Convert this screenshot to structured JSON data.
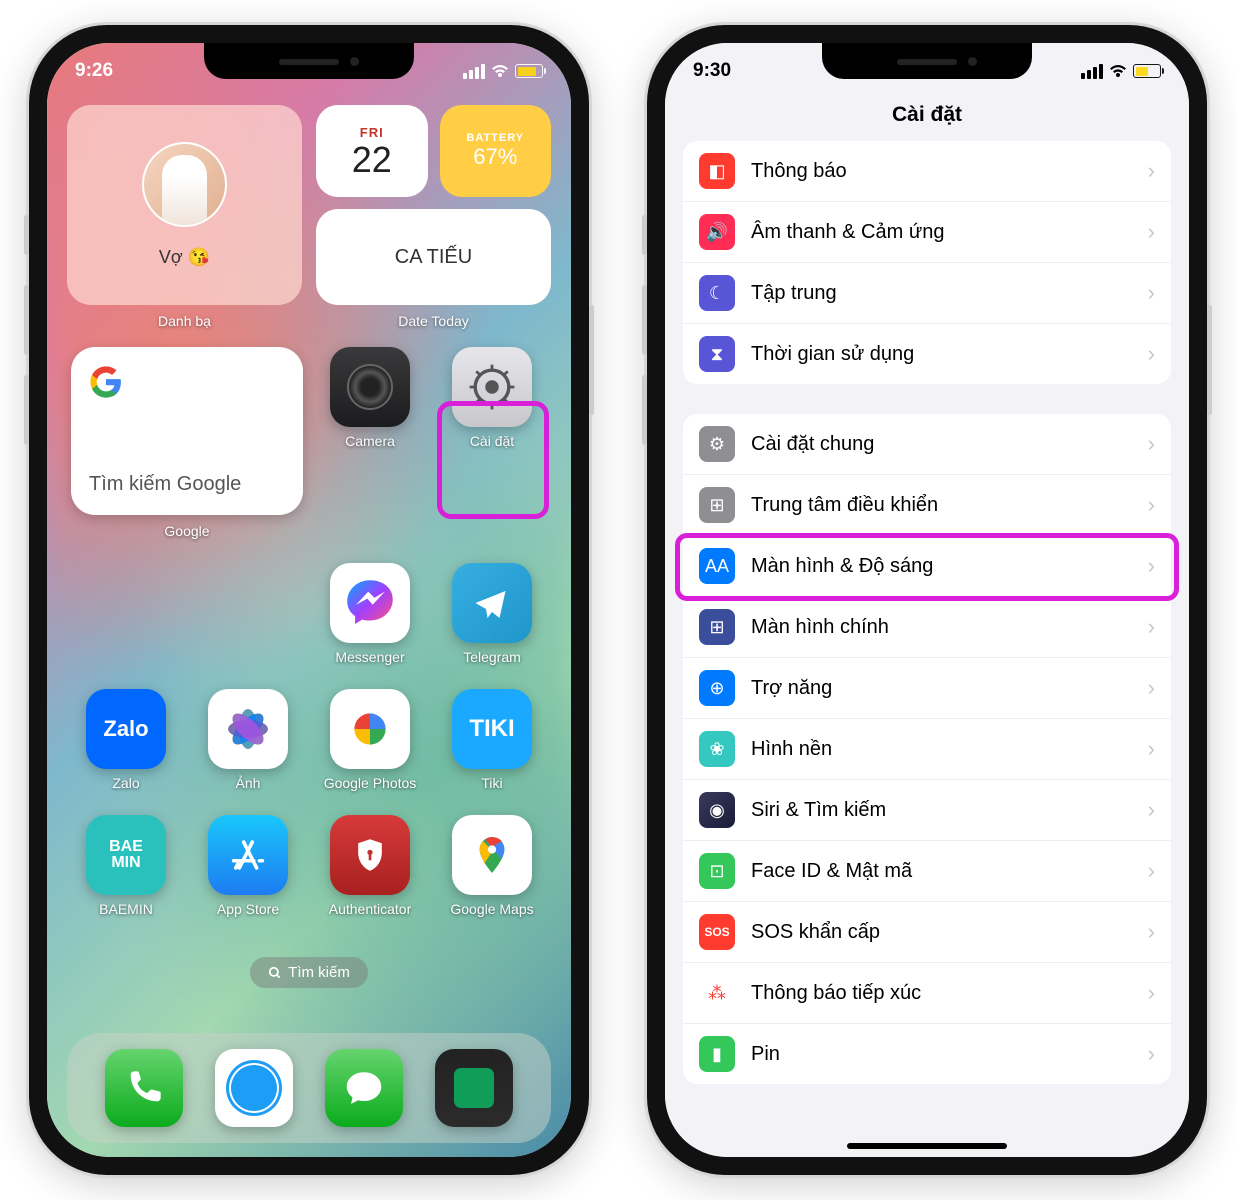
{
  "phone_left": {
    "status": {
      "time": "9:26"
    },
    "widgets": {
      "contact": {
        "name": "Vợ 😘",
        "section_label": "Danh bạ"
      },
      "date": {
        "day": "FRI",
        "num": "22"
      },
      "battery": {
        "label": "BATTERY",
        "percent": "67%"
      },
      "calendar": {
        "text": "CA TIẾU"
      },
      "date_section_label": "Date Today"
    },
    "google_widget": {
      "text": "Tìm kiếm Google",
      "label": "Google"
    },
    "apps": {
      "camera": "Camera",
      "settings": "Cài đặt",
      "messenger": "Messenger",
      "telegram": "Telegram",
      "zalo": "Zalo",
      "zalo_text": "Zalo",
      "photos": "Ảnh",
      "gphotos": "Google Photos",
      "tiki": "Tiki",
      "tiki_text": "TIKI",
      "baemin": "BAEMIN",
      "baemin_text": "BAE\nMIN",
      "appstore": "App Store",
      "auth": "Authenticator",
      "gmaps": "Google Maps"
    },
    "search": "Tìm kiếm"
  },
  "phone_right": {
    "status": {
      "time": "9:30"
    },
    "title": "Cài đặt",
    "group1": [
      {
        "id": "notifications",
        "label": "Thông báo",
        "icon_cls": "si-notif",
        "glyph": "◧"
      },
      {
        "id": "sounds",
        "label": "Âm thanh & Cảm ứng",
        "icon_cls": "si-sound",
        "glyph": "🔊"
      },
      {
        "id": "focus",
        "label": "Tập trung",
        "icon_cls": "si-focus",
        "glyph": "☾"
      },
      {
        "id": "screentime",
        "label": "Thời gian sử dụng",
        "icon_cls": "si-screentime",
        "glyph": "⧗"
      }
    ],
    "group2": [
      {
        "id": "general",
        "label": "Cài đặt chung",
        "icon_cls": "si-general",
        "glyph": "⚙"
      },
      {
        "id": "control-center",
        "label": "Trung tâm điều khiển",
        "icon_cls": "si-cc",
        "glyph": "⊞"
      },
      {
        "id": "display",
        "label": "Màn hình & Độ sáng",
        "icon_cls": "si-display",
        "glyph": "AA"
      },
      {
        "id": "home-screen",
        "label": "Màn hình chính",
        "icon_cls": "si-home",
        "glyph": "⊞"
      },
      {
        "id": "accessibility",
        "label": "Trợ năng",
        "icon_cls": "si-access",
        "glyph": "⊕"
      },
      {
        "id": "wallpaper",
        "label": "Hình nền",
        "icon_cls": "si-wall",
        "glyph": "❀"
      },
      {
        "id": "siri",
        "label": "Siri & Tìm kiếm",
        "icon_cls": "si-siri",
        "glyph": "◉"
      },
      {
        "id": "faceid",
        "label": "Face ID & Mật mã",
        "icon_cls": "si-faceid",
        "glyph": "⊡"
      },
      {
        "id": "sos",
        "label": "SOS khẩn cấp",
        "icon_cls": "si-sos",
        "glyph": "SOS"
      },
      {
        "id": "exposure",
        "label": "Thông báo tiếp xúc",
        "icon_cls": "si-exposure",
        "glyph": "⁂"
      },
      {
        "id": "battery",
        "label": "Pin",
        "icon_cls": "si-batt",
        "glyph": "▮"
      }
    ]
  }
}
